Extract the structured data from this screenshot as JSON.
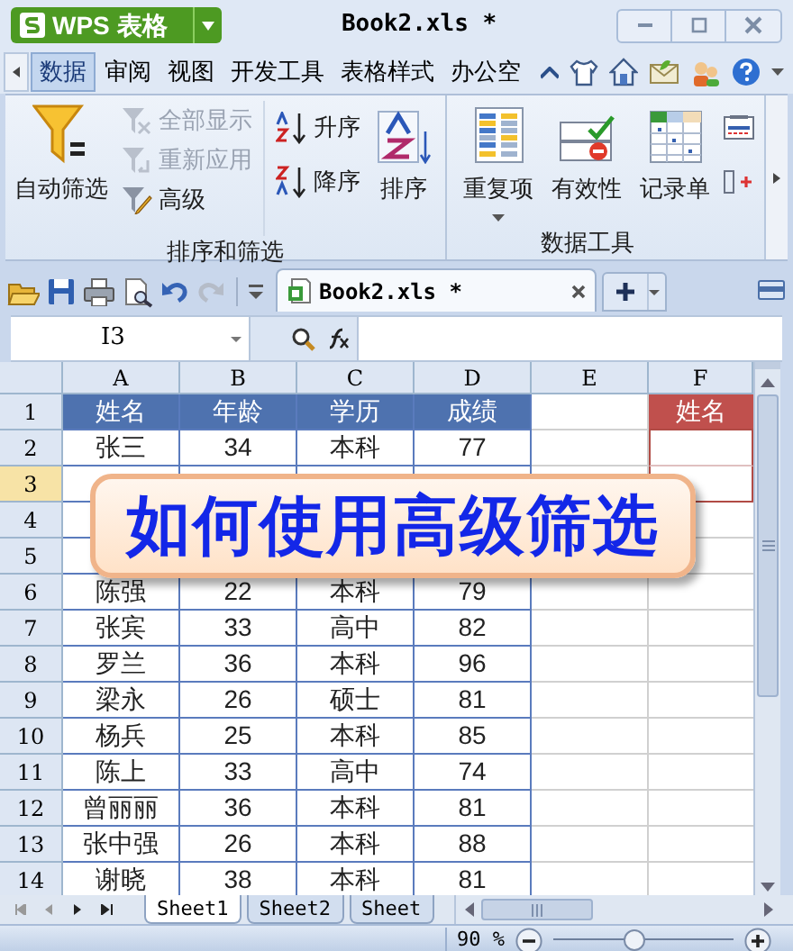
{
  "app_button": {
    "label": "WPS 表格"
  },
  "window": {
    "title": "Book2.xls *"
  },
  "menu_tabs": [
    {
      "label": "数据",
      "selected": true
    },
    {
      "label": "审阅",
      "selected": false
    },
    {
      "label": "视图",
      "selected": false
    },
    {
      "label": "开发工具",
      "selected": false
    },
    {
      "label": "表格样式",
      "selected": false
    },
    {
      "label": "办公空",
      "selected": false
    }
  ],
  "ribbon": {
    "groups": [
      {
        "label": "排序和筛选",
        "items": [
          {
            "kind": "large",
            "label": "自动筛选",
            "disabled": false
          },
          {
            "kind": "small",
            "label": "全部显示",
            "disabled": true
          },
          {
            "kind": "small",
            "label": "重新应用",
            "disabled": true
          },
          {
            "kind": "small",
            "label": "高级",
            "disabled": false
          },
          {
            "kind": "small",
            "label": "升序",
            "disabled": false
          },
          {
            "kind": "small",
            "label": "降序",
            "disabled": false
          },
          {
            "kind": "large",
            "label": "排序",
            "disabled": false
          }
        ]
      },
      {
        "label": "数据工具",
        "items": [
          {
            "kind": "large",
            "label": "重复项",
            "disabled": false
          },
          {
            "kind": "large",
            "label": "有效性",
            "disabled": false
          },
          {
            "kind": "large",
            "label": "记录单",
            "disabled": false
          }
        ]
      }
    ]
  },
  "document_tab": {
    "title": "Book2.xls *"
  },
  "formula_bar": {
    "cell_name": "I3"
  },
  "sheet": {
    "columns": [
      "A",
      "B",
      "C",
      "D",
      "E",
      "F"
    ],
    "rows": [
      {
        "number": "1",
        "selected": false,
        "kind": "header",
        "cells": [
          "姓名",
          "年龄",
          "学历",
          "成绩"
        ],
        "criteria": "姓名"
      },
      {
        "number": "2",
        "selected": false,
        "kind": "data",
        "cells": [
          "张三",
          "34",
          "本科",
          "77"
        ]
      },
      {
        "number": "3",
        "selected": true,
        "kind": "hidden"
      },
      {
        "number": "4",
        "selected": false,
        "kind": "hidden"
      },
      {
        "number": "5",
        "selected": false,
        "kind": "hidden"
      },
      {
        "number": "6",
        "selected": false,
        "kind": "data",
        "cells": [
          "陈强",
          "22",
          "本科",
          "79"
        ]
      },
      {
        "number": "7",
        "selected": false,
        "kind": "data",
        "cells": [
          "张宾",
          "33",
          "高中",
          "82"
        ]
      },
      {
        "number": "8",
        "selected": false,
        "kind": "data",
        "cells": [
          "罗兰",
          "36",
          "本科",
          "96"
        ]
      },
      {
        "number": "9",
        "selected": false,
        "kind": "data",
        "cells": [
          "梁永",
          "26",
          "硕士",
          "81"
        ]
      },
      {
        "number": "10",
        "selected": false,
        "kind": "data",
        "cells": [
          "杨兵",
          "25",
          "本科",
          "85"
        ]
      },
      {
        "number": "11",
        "selected": false,
        "kind": "data",
        "cells": [
          "陈上",
          "33",
          "高中",
          "74"
        ]
      },
      {
        "number": "12",
        "selected": false,
        "kind": "data",
        "cells": [
          "曾丽丽",
          "36",
          "本科",
          "81"
        ]
      },
      {
        "number": "13",
        "selected": false,
        "kind": "data",
        "cells": [
          "张中强",
          "26",
          "本科",
          "88"
        ]
      },
      {
        "number": "14",
        "selected": false,
        "kind": "data",
        "cells": [
          "谢晓",
          "38",
          "本科",
          "81"
        ]
      }
    ]
  },
  "banner": {
    "text": "如何使用高级筛选"
  },
  "sheet_tabs": [
    {
      "label": "Sheet1",
      "selected": true
    },
    {
      "label": "Sheet2",
      "selected": false
    },
    {
      "label": "Sheet",
      "selected": false
    }
  ],
  "status_bar": {
    "zoom": "90 %",
    "zoom_slider": {
      "level": 0.45
    }
  }
}
